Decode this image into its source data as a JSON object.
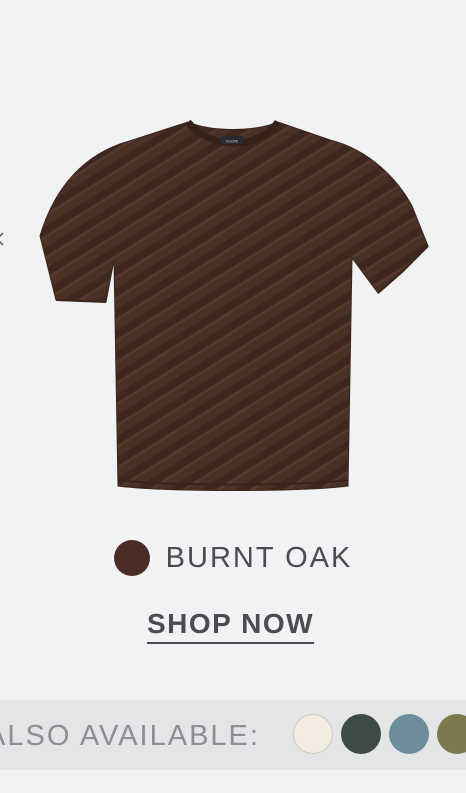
{
  "product": {
    "image_alt": "Brown textured knit t-shirt",
    "neck_label": "VUORI"
  },
  "color": {
    "name": "BURNT OAK",
    "hex": "#4a2c24"
  },
  "cta": {
    "label": "SHOP NOW"
  },
  "also_available": {
    "label": "ALSO AVAILABLE:",
    "swatches": [
      {
        "name": "cream-swatch",
        "hex": "#f3ece1"
      },
      {
        "name": "dark-green-swatch",
        "hex": "#3e4a45"
      },
      {
        "name": "slate-blue-swatch",
        "hex": "#6d8e9b"
      },
      {
        "name": "olive-swatch",
        "hex": "#7a7a4e"
      }
    ]
  },
  "colors": {
    "background": "#f1f2f4",
    "bar_background": "#e4e5e7",
    "text": "#4c4c50",
    "muted_text": "#8e8e92"
  }
}
